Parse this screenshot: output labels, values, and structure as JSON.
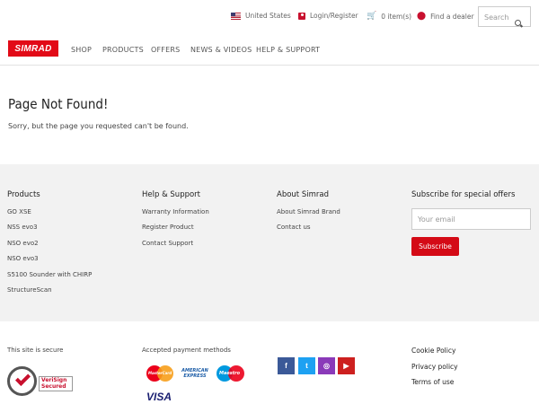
{
  "utility": {
    "country": "United States",
    "login": "Login/Register",
    "cart": "0 item(s)",
    "dealer": "Find a dealer",
    "search_placeholder": "Search"
  },
  "nav": {
    "logo": "SIMRAD",
    "items": [
      "SHOP",
      "PRODUCTS",
      "OFFERS",
      "NEWS & VIDEOS",
      "HELP & SUPPORT"
    ]
  },
  "main": {
    "title": "Page Not Found!",
    "message": "Sorry, but the page you requested can't be found."
  },
  "footer": {
    "products": {
      "heading": "Products",
      "links": [
        "GO XSE",
        "NSS evo3",
        "NSO evo2",
        "NSO evo3",
        "S5100 Sounder with CHIRP",
        "StructureScan"
      ]
    },
    "help": {
      "heading": "Help & Support",
      "links": [
        "Warranty Information",
        "Register Product",
        "Contact Support"
      ]
    },
    "about": {
      "heading": "About Simrad",
      "links": [
        "About Simrad Brand",
        "Contact us"
      ]
    },
    "subscribe": {
      "heading": "Subscribe for special offers",
      "placeholder": "Your email",
      "button": "Subscribe"
    }
  },
  "bottom": {
    "secure_label": "This site is secure",
    "verisign_text": "VeriSign Secured",
    "payment_label": "Accepted payment methods",
    "payments": {
      "mastercard": "MasterCard",
      "amex": "AMERICAN EXPRESS",
      "maestro": "Maestro",
      "visa": "VISA"
    },
    "social": {
      "facebook": "f",
      "twitter": "t",
      "instagram": "◎",
      "youtube": "▶"
    },
    "links": [
      "Cookie Policy",
      "Privacy policy",
      "Terms of use"
    ]
  },
  "colors": {
    "brand_red": "#e20a17",
    "facebook": "#3b5998",
    "twitter": "#1da1f2",
    "instagram": "#8a3ab9",
    "youtube": "#cd201f"
  }
}
